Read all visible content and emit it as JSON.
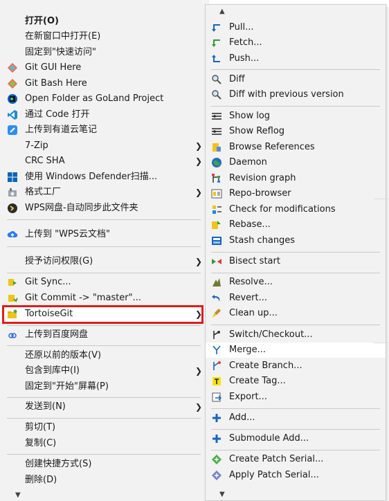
{
  "left_menu": {
    "items": [
      {
        "label": "打开(O)",
        "icon": "",
        "bold": true,
        "submenu": false
      },
      {
        "label": "在新窗口中打开(E)",
        "icon": "",
        "submenu": false
      },
      {
        "label": "固定到\"快速访问\"",
        "icon": "",
        "submenu": false
      },
      {
        "label": "Git GUI Here",
        "icon": "git-gui-icon",
        "submenu": false
      },
      {
        "label": "Git Bash Here",
        "icon": "git-bash-icon",
        "submenu": false
      },
      {
        "label": "Open Folder as GoLand Project",
        "icon": "goland-icon",
        "submenu": false
      },
      {
        "label": "通过 Code 打开",
        "icon": "vscode-icon",
        "submenu": false
      },
      {
        "label": "上传到有道云笔记",
        "icon": "youdao-icon",
        "submenu": false
      },
      {
        "label": "7-Zip",
        "icon": "",
        "submenu": true
      },
      {
        "label": "CRC SHA",
        "icon": "",
        "submenu": true
      },
      {
        "label": "使用 Windows Defender扫描...",
        "icon": "defender-icon",
        "submenu": false
      },
      {
        "label": "格式工厂",
        "icon": "format-factory-icon",
        "submenu": true
      },
      {
        "label": "WPS网盘-自动同步此文件夹",
        "icon": "wps-sync-icon",
        "submenu": false
      },
      {
        "label": "上传到 \"WPS云文档\"",
        "icon": "wps-cloud-icon",
        "submenu": false
      },
      {
        "label": "授予访问权限(G)",
        "icon": "",
        "submenu": true
      },
      {
        "label": "Git Sync...",
        "icon": "git-sync-icon",
        "submenu": false
      },
      {
        "label": "Git Commit -> \"master\"...",
        "icon": "git-commit-icon",
        "submenu": false
      },
      {
        "label": "TortoiseGit",
        "icon": "tortoisegit-icon",
        "submenu": true
      },
      {
        "label": "上传到百度网盘",
        "icon": "baidu-icon",
        "submenu": false
      },
      {
        "label": "还原以前的版本(V)",
        "icon": "",
        "submenu": false
      },
      {
        "label": "包含到库中(I)",
        "icon": "",
        "submenu": true
      },
      {
        "label": "固定到\"开始\"屏幕(P)",
        "icon": "",
        "submenu": false
      },
      {
        "label": "发送到(N)",
        "icon": "",
        "submenu": true
      },
      {
        "label": "剪切(T)",
        "icon": "",
        "submenu": false
      },
      {
        "label": "复制(C)",
        "icon": "",
        "submenu": false
      },
      {
        "label": "创建快捷方式(S)",
        "icon": "",
        "submenu": false
      },
      {
        "label": "删除(D)",
        "icon": "",
        "submenu": false
      }
    ],
    "scroll_down_glyph": "▼"
  },
  "right_menu": {
    "scroll_up_glyph": "▲",
    "scroll_down_glyph": "▼",
    "items": [
      {
        "label": "Pull...",
        "icon": "pull-icon"
      },
      {
        "label": "Fetch...",
        "icon": "fetch-icon"
      },
      {
        "label": "Push...",
        "icon": "push-icon"
      },
      {
        "label": "Diff",
        "icon": "diff-icon"
      },
      {
        "label": "Diff with previous version",
        "icon": "diff-prev-icon"
      },
      {
        "label": "Show log",
        "icon": "show-log-icon"
      },
      {
        "label": "Show Reflog",
        "icon": "show-reflog-icon"
      },
      {
        "label": "Browse References",
        "icon": "browse-references-icon"
      },
      {
        "label": "Daemon",
        "icon": "daemon-icon"
      },
      {
        "label": "Revision graph",
        "icon": "revision-graph-icon"
      },
      {
        "label": "Repo-browser",
        "icon": "repo-browser-icon"
      },
      {
        "label": "Check for modifications",
        "icon": "check-modifications-icon"
      },
      {
        "label": "Rebase...",
        "icon": "rebase-icon"
      },
      {
        "label": "Stash changes",
        "icon": "stash-icon"
      },
      {
        "label": "Bisect start",
        "icon": "bisect-icon"
      },
      {
        "label": "Resolve...",
        "icon": "resolve-icon"
      },
      {
        "label": "Revert...",
        "icon": "revert-icon"
      },
      {
        "label": "Clean up...",
        "icon": "cleanup-icon"
      },
      {
        "label": "Switch/Checkout...",
        "icon": "switch-icon"
      },
      {
        "label": "Merge...",
        "icon": "merge-icon"
      },
      {
        "label": "Create Branch...",
        "icon": "create-branch-icon"
      },
      {
        "label": "Create Tag...",
        "icon": "create-tag-icon"
      },
      {
        "label": "Export...",
        "icon": "export-icon"
      },
      {
        "label": "Add...",
        "icon": "add-icon"
      },
      {
        "label": "Submodule Add...",
        "icon": "submodule-add-icon"
      },
      {
        "label": "Create Patch Serial...",
        "icon": "create-patch-icon"
      },
      {
        "label": "Apply Patch Serial...",
        "icon": "apply-patch-icon"
      }
    ]
  },
  "colors": {
    "highlight_border": "#e01b1b",
    "menu_bg": "#f2f2f2",
    "hover_bg": "#ffffff"
  }
}
